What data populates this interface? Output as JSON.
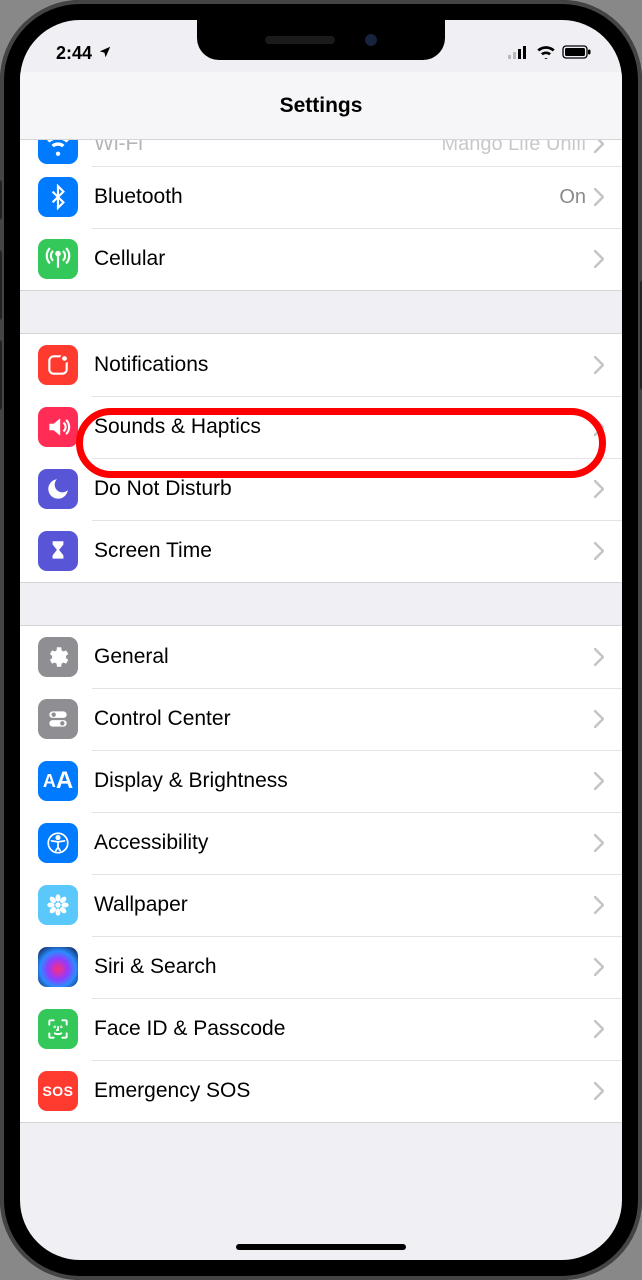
{
  "status": {
    "time": "2:44",
    "location_icon": "↗"
  },
  "nav": {
    "title": "Settings"
  },
  "rows": {
    "wifi": {
      "label": "Wi-Fi",
      "value": "Mango Life Unifi",
      "color": "#007aff"
    },
    "bluetooth": {
      "label": "Bluetooth",
      "value": "On",
      "color": "#007aff"
    },
    "cellular": {
      "label": "Cellular",
      "value": "",
      "color": "#34c759"
    },
    "notifications": {
      "label": "Notifications",
      "value": "",
      "color": "#ff3b30"
    },
    "sounds": {
      "label": "Sounds & Haptics",
      "value": "",
      "color": "#ff2d55"
    },
    "dnd": {
      "label": "Do Not Disturb",
      "value": "",
      "color": "#5856d6"
    },
    "screentime": {
      "label": "Screen Time",
      "value": "",
      "color": "#5856d6"
    },
    "general": {
      "label": "General",
      "value": "",
      "color": "#8e8e93"
    },
    "controlcenter": {
      "label": "Control Center",
      "value": "",
      "color": "#8e8e93"
    },
    "display": {
      "label": "Display & Brightness",
      "value": "",
      "color": "#007aff"
    },
    "accessibility": {
      "label": "Accessibility",
      "value": "",
      "color": "#007aff"
    },
    "wallpaper": {
      "label": "Wallpaper",
      "value": "",
      "color": "#5ac8fa"
    },
    "siri": {
      "label": "Siri & Search",
      "value": "",
      "color": "#1c1c1e"
    },
    "faceid": {
      "label": "Face ID & Passcode",
      "value": "",
      "color": "#34c759"
    },
    "sos": {
      "label": "Emergency SOS",
      "value": "",
      "color": "#ff3b30"
    }
  },
  "icons": {
    "wifi": "wifi-icon",
    "bluetooth": "bluetooth-icon",
    "cellular": "antenna-icon",
    "notifications": "notification-icon",
    "sounds": "speaker-icon",
    "dnd": "moon-icon",
    "screentime": "hourglass-icon",
    "general": "gear-icon",
    "controlcenter": "switches-icon",
    "display": "aa-icon",
    "accessibility": "accessibility-icon",
    "wallpaper": "flower-icon",
    "siri": "siri-icon",
    "faceid": "face-icon",
    "sos": "sos-icon"
  }
}
